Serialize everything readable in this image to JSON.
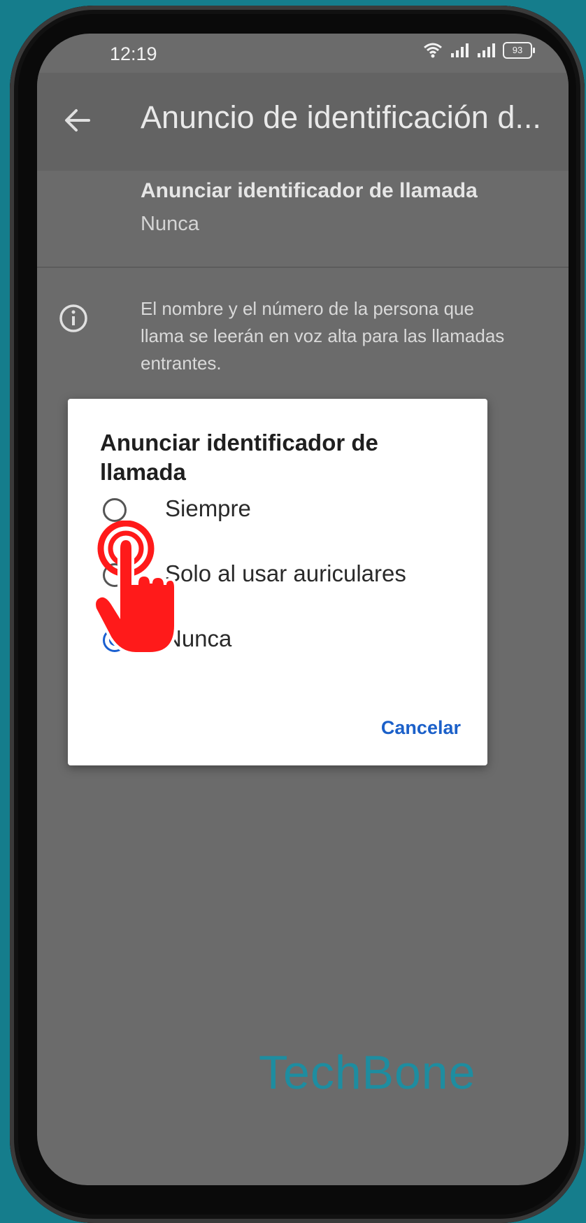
{
  "status_bar": {
    "time": "12:19",
    "battery": "93",
    "icons": [
      "wifi-icon",
      "signal-icon",
      "signal-icon",
      "battery-icon"
    ]
  },
  "app_bar": {
    "title": "Anuncio de identificación d..."
  },
  "setting": {
    "title": "Anunciar identificador de llamada",
    "value": "Nunca"
  },
  "info": {
    "text": "El nombre y el número de la persona que llama se leerán en voz alta para las llamadas entrantes."
  },
  "dialog": {
    "title": "Anunciar identificador de llamada",
    "options": [
      {
        "label": "Siempre",
        "selected": false
      },
      {
        "label": "Solo al usar auriculares",
        "selected": false
      },
      {
        "label": "Nunca",
        "selected": true
      }
    ],
    "cancel_label": "Cancelar"
  },
  "colors": {
    "accent": "#1a5fd0",
    "background": "#157d8c",
    "overlay": "#6b6b6b",
    "tap_indicator": "#ff1a1a"
  },
  "watermark": "TechBone"
}
